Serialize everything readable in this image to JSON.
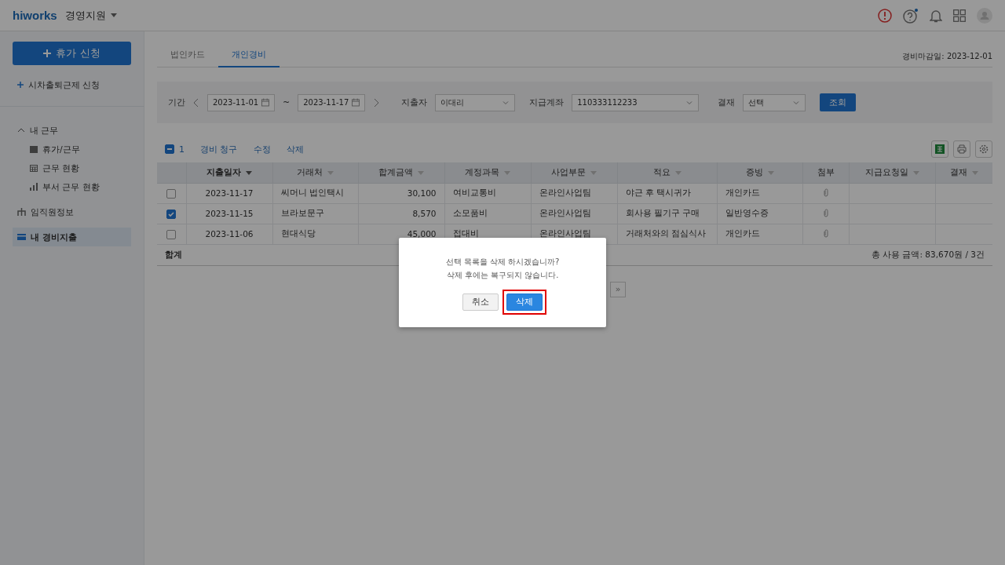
{
  "topbar": {
    "logo": "hiworks",
    "app": "경영지원",
    "notice_dot": true
  },
  "sidebar": {
    "primary": "휴가 신청",
    "secondary": "시차출퇴근제 신청",
    "items": [
      {
        "label": "내 근무",
        "selected": false,
        "expanded": true,
        "children": [
          {
            "label": "휴가/근무",
            "selected": false
          },
          {
            "label": "근무 현황",
            "selected": false
          },
          {
            "label": "부서 근무 현황",
            "selected": false
          }
        ]
      },
      {
        "label": "임직원정보",
        "selected": false
      },
      {
        "label": "내 경비지출",
        "selected": true
      }
    ]
  },
  "tabs": [
    {
      "label": "법인카드",
      "selected": false
    },
    {
      "label": "개인경비",
      "selected": true
    }
  ],
  "deadline": "경비마감일: 2023-12-01",
  "filters": {
    "period_label": "기간",
    "start": "2023-11-01",
    "tilde": "~",
    "end": "2023-11-17",
    "spender_label": "지출자",
    "spender": "이대리",
    "account_label": "지급계좌",
    "account": "110333112233",
    "approval_label": "결재",
    "approval": "선택",
    "search": "조회"
  },
  "actions": {
    "checked": true,
    "count": "1",
    "items": [
      "경비 청구",
      "수정",
      "삭제"
    ]
  },
  "table": {
    "columns": [
      {
        "label": "지출일자",
        "sortable": true,
        "sorted": true
      },
      {
        "label": "거래처",
        "sortable": true,
        "sorted": false
      },
      {
        "label": "합계금액",
        "sortable": true,
        "sorted": false
      },
      {
        "label": "계정과목",
        "sortable": true,
        "sorted": false
      },
      {
        "label": "사업부문",
        "sortable": true,
        "sorted": false
      },
      {
        "label": "적요",
        "sortable": true,
        "sorted": false
      },
      {
        "label": "증빙",
        "sortable": true,
        "sorted": false
      },
      {
        "label": "첨부",
        "sortable": false,
        "sorted": false
      },
      {
        "label": "지급요청일",
        "sortable": true,
        "sorted": false
      },
      {
        "label": "결재",
        "sortable": true,
        "sorted": false
      }
    ],
    "rows": [
      {
        "checked": false,
        "attachment": true,
        "cells": [
          "2023-11-17",
          "씨머니 법인택시",
          "30,100",
          "여비교통비",
          "온라인사업팀",
          "야근 후 택시귀가",
          "개인카드"
        ]
      },
      {
        "checked": true,
        "attachment": true,
        "cells": [
          "2023-11-15",
          "브라보문구",
          "8,570",
          "소모품비",
          "온라인사업팀",
          "회사용 필기구 구매",
          "일반영수증"
        ]
      },
      {
        "checked": false,
        "attachment": true,
        "cells": [
          "2023-11-06",
          "현대식당",
          "45,000",
          "접대비",
          "온라인사업팀",
          "거래처와의 점심식사",
          "개인카드"
        ]
      }
    ],
    "footer_label": "합계",
    "footer_total": "총 사용 금액: 83,670원 / 3건"
  },
  "pagination": {
    "last": "»"
  },
  "dialog": {
    "lines": [
      "선택 목록을 삭제 하시겠습니까?",
      "삭제 후에는 복구되지 않습니다."
    ],
    "buttons": [
      {
        "label": "취소",
        "kind": "cancel",
        "highlighted": false
      },
      {
        "label": "삭제",
        "kind": "confirm",
        "highlighted": true
      }
    ]
  }
}
